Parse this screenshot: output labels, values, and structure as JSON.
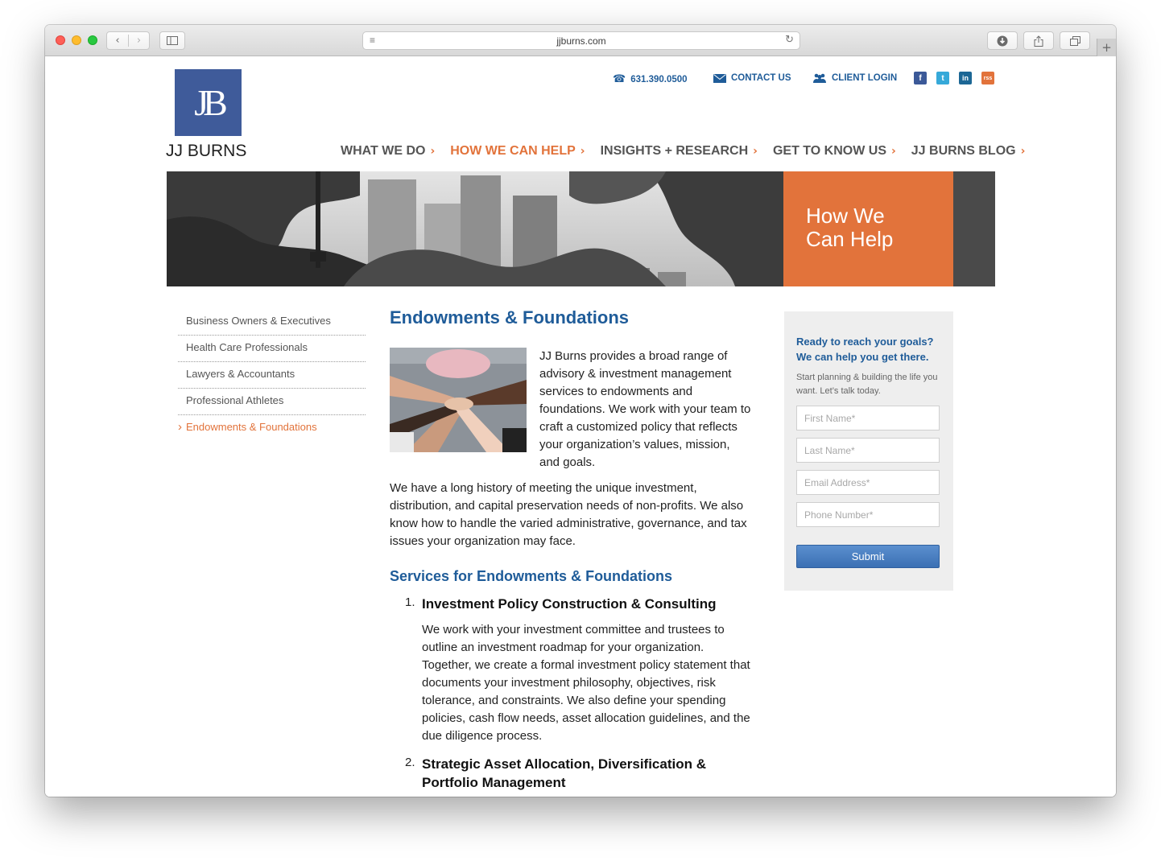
{
  "browser": {
    "url": "jjburns.com",
    "back_glyph": "‹",
    "forward_glyph": "›",
    "new_tab_glyph": "+"
  },
  "brand": {
    "logo_monogram": "JB",
    "name": "JJ BURNS",
    "blue": "#3f5b9a",
    "orange": "#e2733b",
    "link_blue": "#1f5c99"
  },
  "utility": {
    "phone": "631.390.0500",
    "contact": "CONTACT US",
    "login": "CLIENT LOGIN",
    "social": [
      "f",
      "t",
      "in",
      "rss"
    ]
  },
  "nav": {
    "items": [
      {
        "label": "WHAT WE DO"
      },
      {
        "label": "HOW WE CAN HELP"
      },
      {
        "label": "INSIGHTS + RESEARCH"
      },
      {
        "label": "GET TO KNOW US"
      },
      {
        "label": "JJ BURNS BLOG"
      }
    ],
    "active_index": 1,
    "chevron": "›"
  },
  "banner": {
    "line1": "How We",
    "line2": "Can Help"
  },
  "subnav": {
    "items": [
      {
        "label": "Business Owners & Executives"
      },
      {
        "label": "Health Care Professionals"
      },
      {
        "label": "Lawyers & Accountants"
      },
      {
        "label": "Professional Athletes"
      },
      {
        "label": "Endowments & Foundations"
      }
    ],
    "active_index": 4
  },
  "content": {
    "title": "Endowments & Foundations",
    "intro": "JJ Burns provides a broad range of advisory & investment management services to endowments and foundations. We work with your team to craft a customized policy that reflects your organization’s values, mission, and goals.",
    "para2": "We have a long history of meeting the unique investment, distribution, and capital preservation needs of non-profits. We also know how to handle the varied administrative, governance, and tax issues your organization may face.",
    "services_heading": "Services for Endowments & Foundations",
    "services": [
      {
        "num": "1.",
        "title": "Investment Policy Construction & Consulting",
        "desc": "We work with your investment committee and trustees to outline an investment roadmap for your organization. Together, we create a formal investment policy statement that documents your investment philosophy, objectives, risk tolerance, and constraints. We also define your spending policies, cash flow needs, asset allocation guidelines, and the due diligence process."
      },
      {
        "num": "2.",
        "title": "Strategic Asset Allocation, Diversification & Portfolio Management",
        "desc": ""
      }
    ]
  },
  "form": {
    "heading_line1": "Ready to reach your goals?",
    "heading_line2": "We can help you get there.",
    "sub": "Start planning & building the life you want. Let’s talk today.",
    "first_name": "First Name*",
    "last_name": "Last Name*",
    "email": "Email Address*",
    "phone": "Phone Number*",
    "submit": "Submit"
  }
}
